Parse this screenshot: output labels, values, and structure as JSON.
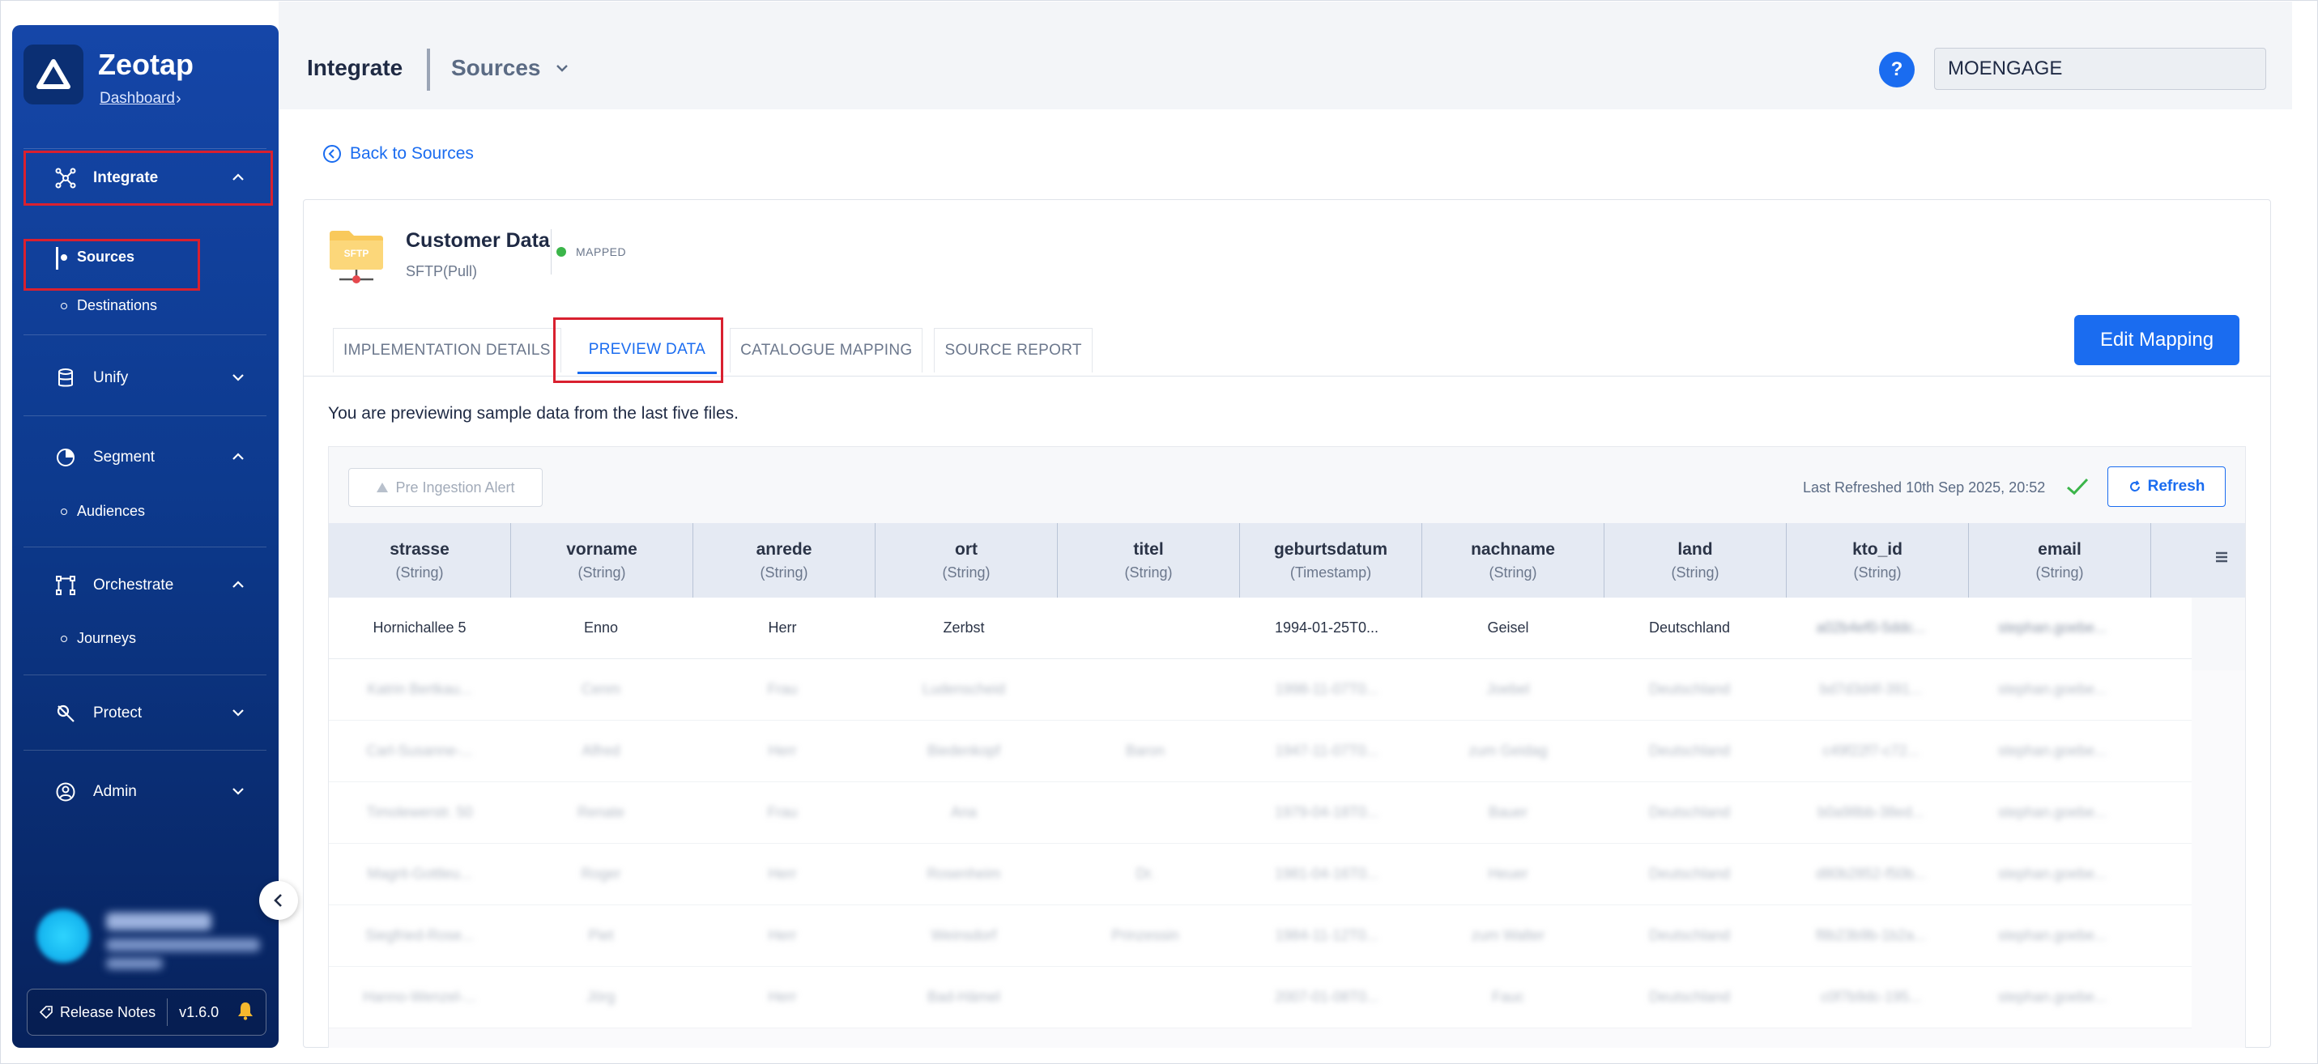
{
  "sidebar": {
    "brand": "Zeotap",
    "dashboard_link": "Dashboard",
    "nav": [
      {
        "label": "Integrate",
        "expanded": true,
        "children": [
          "Sources",
          "Destinations"
        ]
      },
      {
        "label": "Unify",
        "expanded": false
      },
      {
        "label": "Segment",
        "expanded": true,
        "children": [
          "Audiences"
        ]
      },
      {
        "label": "Orchestrate",
        "expanded": true,
        "children": [
          "Journeys"
        ]
      },
      {
        "label": "Protect",
        "expanded": false
      },
      {
        "label": "Admin",
        "expanded": false
      }
    ],
    "release_notes": "Release Notes",
    "version": "v1.6.0"
  },
  "header": {
    "title": "Integrate",
    "subtitle": "Sources",
    "help": "?",
    "org_value": "MOENGAGE"
  },
  "main": {
    "back_link": "Back to Sources",
    "source": {
      "icon_text": "SFTP",
      "title": "Customer Data",
      "type": "SFTP(Pull)",
      "status": "MAPPED"
    },
    "tabs": [
      "IMPLEMENTATION DETAILS",
      "PREVIEW DATA",
      "CATALOGUE MAPPING",
      "SOURCE REPORT"
    ],
    "active_tab": "PREVIEW DATA",
    "edit_button": "Edit Mapping",
    "preview_note": "You are previewing sample data from the last five files.",
    "pre_ingestion_button": "Pre Ingestion Alert",
    "last_refreshed": "Last Refreshed 10th Sep 2025, 20:52",
    "refresh_button": "Refresh",
    "table": {
      "columns": [
        {
          "name": "strasse",
          "type": "(String)"
        },
        {
          "name": "vorname",
          "type": "(String)"
        },
        {
          "name": "anrede",
          "type": "(String)"
        },
        {
          "name": "ort",
          "type": "(String)"
        },
        {
          "name": "titel",
          "type": "(String)"
        },
        {
          "name": "geburtsdatum",
          "type": "(Timestamp)"
        },
        {
          "name": "nachname",
          "type": "(String)"
        },
        {
          "name": "land",
          "type": "(String)"
        },
        {
          "name": "kto_id",
          "type": "(String)"
        },
        {
          "name": "email",
          "type": "(String)"
        }
      ],
      "rows": [
        [
          "Hornichallee 5",
          "Enno",
          "Herr",
          "Zerbst",
          "",
          "1994-01-25T0...",
          "Geisel",
          "Deutschland",
          "a02b4ef0-5ddc...",
          "stephan.goebe..."
        ],
        [
          "Katrin Bertkau...",
          "Cenm",
          "Frau",
          "Ludenscheid",
          "",
          "1998-11-07T0...",
          "Joebel",
          "Deutschland",
          "bd7d3d4f-391...",
          "stephan.goebe..."
        ],
        [
          "Carl-Susanne-...",
          "Alfred",
          "Herr",
          "Biedenkopf",
          "Baron",
          "1947-11-07T0...",
          "zum Geidag",
          "Deutschland",
          "c49f22f7-c72...",
          "stephan.goebe..."
        ],
        [
          "Timolewerstr. 50",
          "Renate",
          "Frau",
          "Ana",
          "",
          "1979-04-18T0...",
          "Bauer",
          "Deutschland",
          "b0a98bb-38ed...",
          "stephan.goebe..."
        ],
        [
          "Magrit-Gottleu...",
          "Roger",
          "Herr",
          "Rosenheim",
          "Dr.",
          "1981-04-16T0...",
          "Heuer",
          "Deutschland",
          "d80b2852-f50b...",
          "stephan.goebe..."
        ],
        [
          "Siegfried-Rose...",
          "Piet",
          "Herr",
          "Weinsdorf",
          "Prinzessin",
          "1984-11-12T0...",
          "zum Walter",
          "Deutschland",
          "f8b23b9b-1b2a...",
          "stephan.goebe..."
        ],
        [
          "Hanno-Wenzel-...",
          "Jörg",
          "Herr",
          "Bad-Hämel",
          "",
          "2007-01-08T0...",
          "Fauc",
          "Deutschland",
          "c0f7b9dc-195...",
          "stephan.goebe..."
        ]
      ]
    }
  },
  "colors": {
    "accent": "#1a6cf0",
    "sidebar": "#0d3a8e",
    "status_mapped": "#3bb54a",
    "highlight": "#d9202f"
  }
}
